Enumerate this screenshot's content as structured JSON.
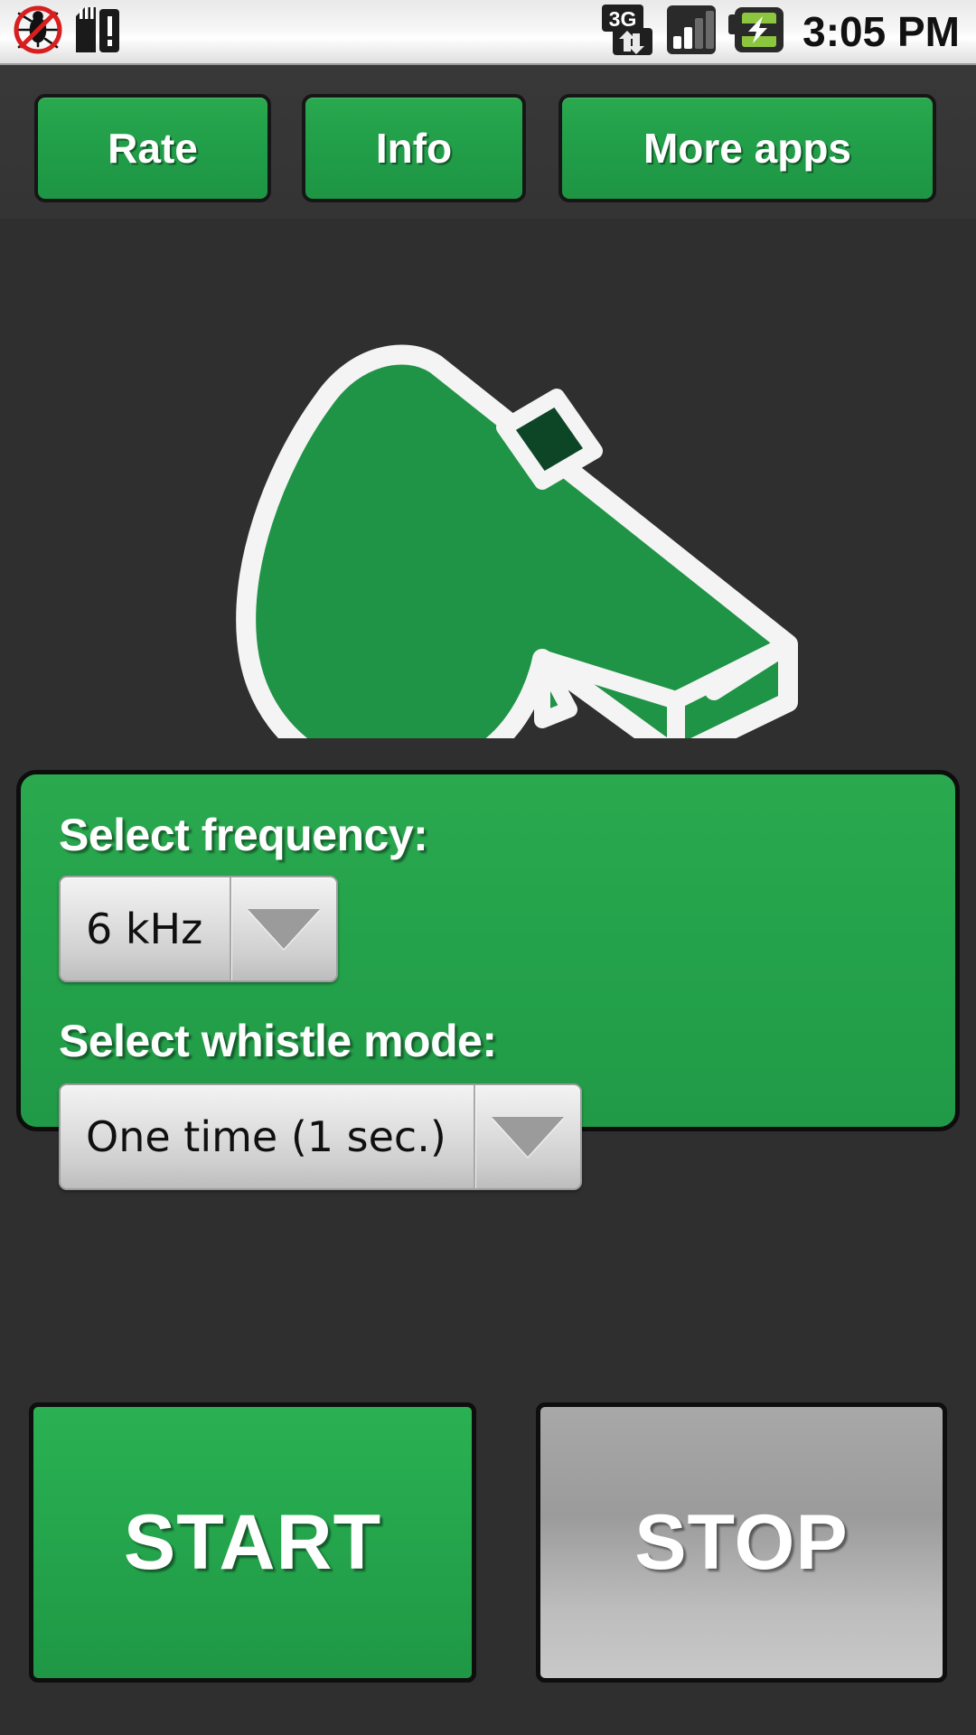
{
  "statusbar": {
    "left_icons": [
      {
        "name": "no-bug-icon",
        "label": "no-bug"
      },
      {
        "name": "sdcard-warning-icon",
        "label": "sd-card-alert"
      }
    ],
    "right_icons": [
      {
        "name": "network-3g-icon",
        "label": "3G",
        "network": "3G"
      },
      {
        "name": "signal-bars-icon",
        "label": "signal",
        "bars_filled": 2,
        "bars_total": 4
      },
      {
        "name": "battery-charging-icon",
        "label": "battery-charging"
      }
    ],
    "clock": "3:05 PM"
  },
  "toolbar": {
    "rate_label": "Rate",
    "info_label": "Info",
    "more_apps_label": "More apps"
  },
  "logo": {
    "name": "whistle-logo",
    "body_color": "#1f9346",
    "outline_color": "#f4f4f4",
    "hole_color": "#0d4527"
  },
  "panel": {
    "frequency_label": "Select frequency:",
    "frequency_value": "6 kHz",
    "mode_label": "Select whistle mode:",
    "mode_value": "One time (1 sec.)"
  },
  "actions": {
    "start_label": "START",
    "stop_label": "STOP"
  },
  "colors": {
    "accent_green": "#22a04a",
    "background_dark": "#343434",
    "button_border": "#0e0e0e",
    "stop_gray": "#a8a8a8",
    "text_white": "#ffffff"
  }
}
